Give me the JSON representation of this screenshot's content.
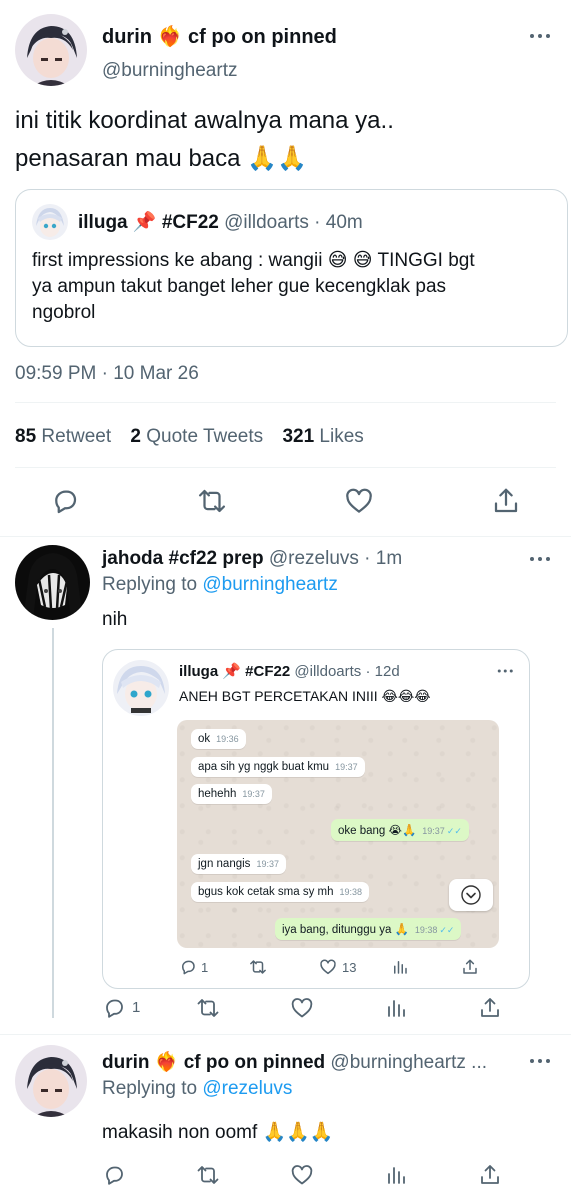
{
  "main_tweet": {
    "display_name": "durin ❤️‍🔥  cf po on pinned",
    "handle": "@burningheartz",
    "text_line1": "ini titik koordinat awalnya mana ya..",
    "text_line2": "penasaran mau baca 🙏🙏",
    "quote": {
      "display_name": "illuga 📌 #CF22",
      "handle": "@illdoarts · 40m",
      "text_line1": "first impressions ke abang : wangii 😅 😅  TINGGI bgt",
      "text_line2": "ya ampun takut banget leher gue kecengklak pas",
      "text_line3": "ngobrol"
    },
    "timestamp": "09:59 PM · 10 Mar 26",
    "retweets_count": "85",
    "retweets_label": "Retweet",
    "quotes_count": "2",
    "quotes_label": "Quote Tweets",
    "likes_count": "321",
    "likes_label": "Likes"
  },
  "reply1": {
    "display_name": "jahoda #cf22 prep",
    "handle": "@rezeluvs · 1m",
    "replying_prefix": "Replying to",
    "replying_to": "@burningheartz",
    "text": "nih",
    "embedded": {
      "display_name": "illuga 📌 #CF22",
      "handle": "@illdoarts · 12d",
      "text": "ANEH BGT PERCETAKAN INIII 😂😂😂",
      "replies": "1",
      "likes": "13",
      "chat": [
        {
          "dir": "in",
          "text": "ok",
          "time": "19:36"
        },
        {
          "dir": "in",
          "text": "apa sih yg nggk buat kmu",
          "time": "19:37"
        },
        {
          "dir": "in",
          "text": "hehehh",
          "time": "19:37"
        },
        {
          "dir": "out",
          "text": "oke bang 😭🙏",
          "time": "19:37"
        },
        {
          "dir": "in",
          "text": "jgn nangis",
          "time": "19:37"
        },
        {
          "dir": "in",
          "text": "bgus kok cetak sma sy mh",
          "time": "19:38"
        },
        {
          "dir": "out",
          "text": "iya bang, ditunggu ya 🙏",
          "time": "19:38"
        }
      ]
    },
    "reply_count": "1"
  },
  "reply2": {
    "display_name": "durin ❤️‍🔥  cf po on pinned",
    "handle": "@burningheartz ...",
    "replying_prefix": "Replying to",
    "replying_to": "@rezeluvs",
    "text": "makasih non oomf 🙏🙏🙏"
  },
  "icons": [
    "more-icon",
    "reply-icon",
    "retweet-icon",
    "like-icon",
    "share-icon",
    "views-icon",
    "chevron-down-icon",
    "pin-icon"
  ],
  "colors": {
    "link": "#1d9bf0",
    "secondary": "#536471",
    "wa_in": "#ffffff",
    "wa_out": "#dcf8c6",
    "wa_bg": "#e5ddd5"
  }
}
